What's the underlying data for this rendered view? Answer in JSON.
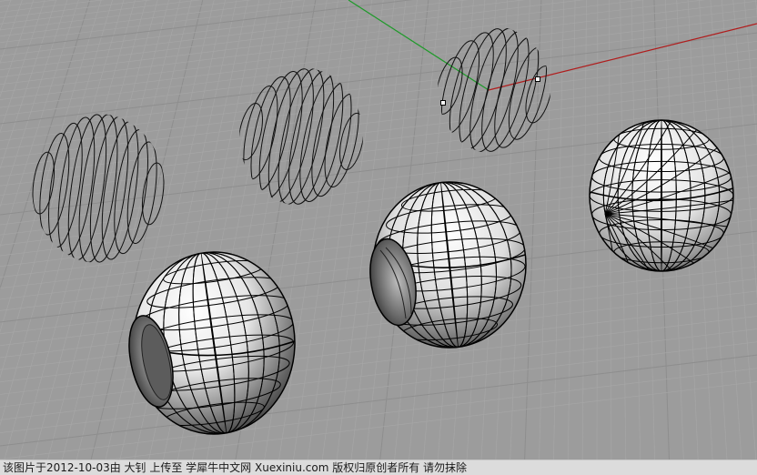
{
  "colors": {
    "background": "#9c9c9c",
    "grid_minor": "#a6a6a6",
    "grid_major": "#8e8e8e",
    "axis_x": "#b01c1c",
    "axis_y": "#1f9a2a",
    "wire": "#111111",
    "surface_light": "#ffffff",
    "surface_dark": "#3a3a3a"
  },
  "objects": [
    {
      "name": "wireframe-curves-sphere-1",
      "type": "wireframe-curves"
    },
    {
      "name": "wireframe-curves-sphere-2",
      "type": "wireframe-curves"
    },
    {
      "name": "wireframe-curves-sphere-3-selected",
      "type": "wireframe-curves",
      "selected": true
    },
    {
      "name": "shaded-sphere-with-hole-front",
      "type": "shaded-surface"
    },
    {
      "name": "shaded-sphere-with-hole-middle",
      "type": "shaded-surface"
    },
    {
      "name": "shaded-sphere-poles",
      "type": "shaded-surface"
    }
  ],
  "watermark": {
    "text": "该图片于2012-10-03由 大钊 上传至 学犀牛中文网 Xuexiniu.com 版权归原创者所有 请勿抹除"
  }
}
